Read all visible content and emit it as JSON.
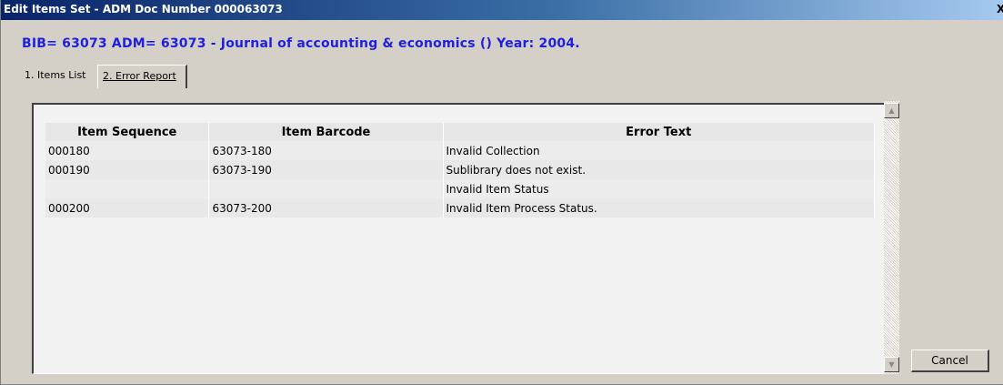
{
  "window": {
    "title": "Edit Items Set - ADM Doc Number 000063073",
    "close_glyph": "X"
  },
  "record_heading": "BIB= 63073 ADM= 63073 - Journal of accounting & economics () Year: 2004.",
  "tabs": [
    {
      "label": "1. Items List",
      "active": false
    },
    {
      "label": "2. Error Report",
      "active": true
    }
  ],
  "error_table": {
    "headers": [
      "Item Sequence",
      "Item Barcode",
      "Error Text"
    ],
    "rows": [
      [
        "000180",
        "63073-180",
        "Invalid Collection"
      ],
      [
        "000190",
        "63073-190",
        "Sublibrary does not exist."
      ],
      [
        "",
        "",
        "Invalid Item Status"
      ],
      [
        "000200",
        "63073-200",
        "Invalid Item Process Status."
      ]
    ]
  },
  "scrollbar": {
    "up_glyph": "▲",
    "down_glyph": "▼"
  },
  "buttons": {
    "cancel": "Cancel"
  },
  "colors": {
    "titlebar_start": "#0a246a",
    "heading_text": "#1f1fe0",
    "window_face": "#d4d0c8"
  }
}
